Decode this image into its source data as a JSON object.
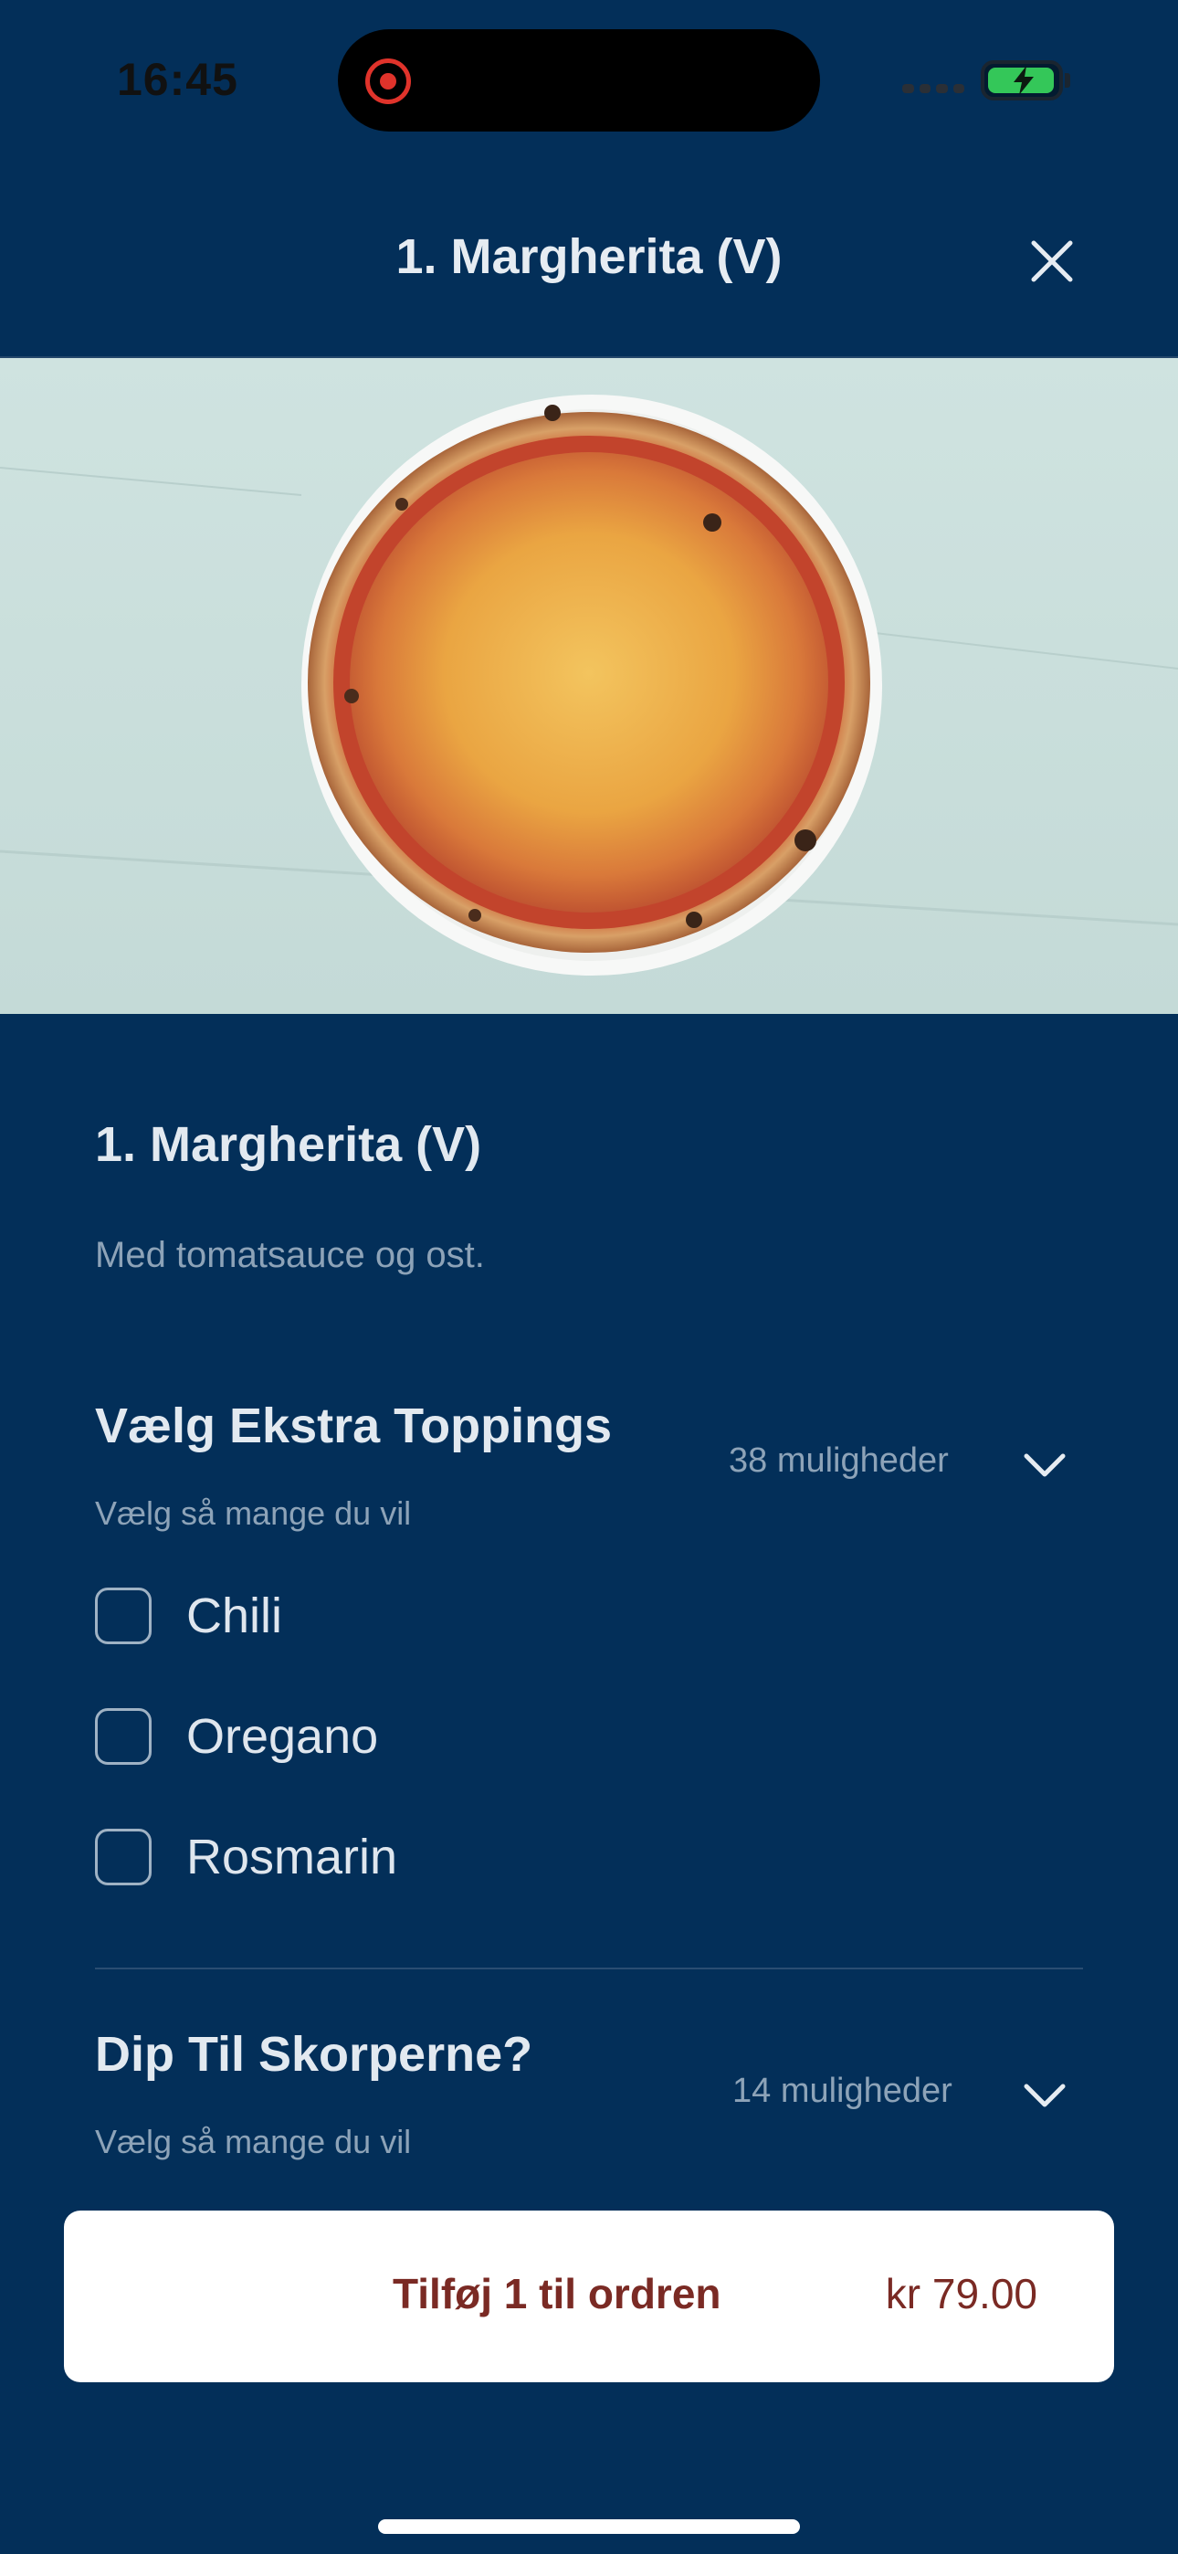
{
  "status_bar": {
    "time": "16:45",
    "icons": [
      "screen-recording-icon",
      "cellular-signal-icon",
      "battery-charging-icon"
    ],
    "battery_color": "#34c759"
  },
  "header": {
    "title": "1. Margherita (V)",
    "close_icon": "close-icon"
  },
  "hero": {
    "image": "margherita-pizza-photo"
  },
  "item": {
    "title": "1. Margherita (V)",
    "description": "Med tomatsauce og ost."
  },
  "groups": [
    {
      "title": "Vælg Ekstra Toppings",
      "subtitle": "Vælg så mange du vil",
      "count": "38 muligheder",
      "expanded": true,
      "options": [
        {
          "label": "Chili",
          "checked": false
        },
        {
          "label": "Oregano",
          "checked": false
        },
        {
          "label": "Rosmarin",
          "checked": false
        }
      ]
    },
    {
      "title": "Dip Til Skorperne?",
      "subtitle": "Vælg så mange du vil",
      "count": "14 muligheder",
      "expanded": false,
      "options": []
    }
  ],
  "add_button": {
    "label": "Tilføj 1 til ordren",
    "price": "kr 79.00"
  },
  "colors": {
    "background": "#032f59",
    "button_text": "#7a2a24",
    "muted_text": "#8da3b8"
  }
}
